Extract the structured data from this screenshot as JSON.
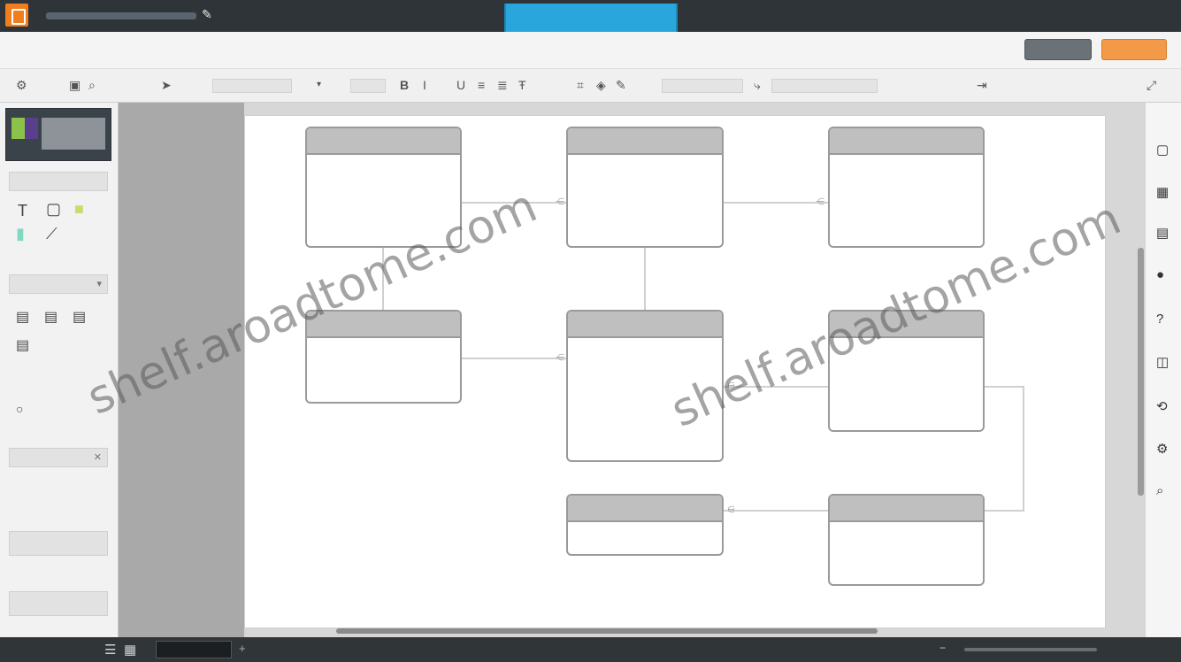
{
  "titlebar": {
    "doc_title": "",
    "center_tab": "",
    "user_menu": ""
  },
  "menu": {
    "items": [
      "",
      "",
      "",
      "",
      "",
      "",
      "",
      "",
      "",
      ""
    ],
    "online": "",
    "share": "",
    "present": ""
  },
  "toolbar": {
    "font_family": "",
    "font_size": "",
    "line_style": "",
    "line_width": ""
  },
  "left_panel": {
    "sections": [
      "",
      "",
      ""
    ],
    "shapes_note": "",
    "more_shapes": "",
    "bottom_button": ""
  },
  "diagram": {
    "entities": [
      {
        "title": "",
        "rows": [
          "",
          "",
          ""
        ]
      },
      {
        "title": "",
        "rows": [
          "",
          "",
          ""
        ]
      },
      {
        "title": "",
        "rows": [
          "",
          "",
          ""
        ]
      },
      {
        "title": "",
        "rows": [
          "",
          ""
        ]
      },
      {
        "title": "",
        "rows": [
          "",
          "",
          "",
          ""
        ]
      },
      {
        "title": "",
        "rows": [
          "",
          "",
          ""
        ]
      },
      {
        "title": "",
        "rows": [
          ""
        ]
      },
      {
        "title": "",
        "rows": [
          "",
          ""
        ]
      }
    ]
  },
  "watermark": "shelf.aroadtome.com",
  "statusbar": {
    "page_tab": "",
    "zoom": ""
  },
  "colors": {
    "accent": "#29a7dd",
    "present_button": "#f29a48",
    "titlebar": "#2f3438",
    "entity_header": "#bfbfbf"
  }
}
